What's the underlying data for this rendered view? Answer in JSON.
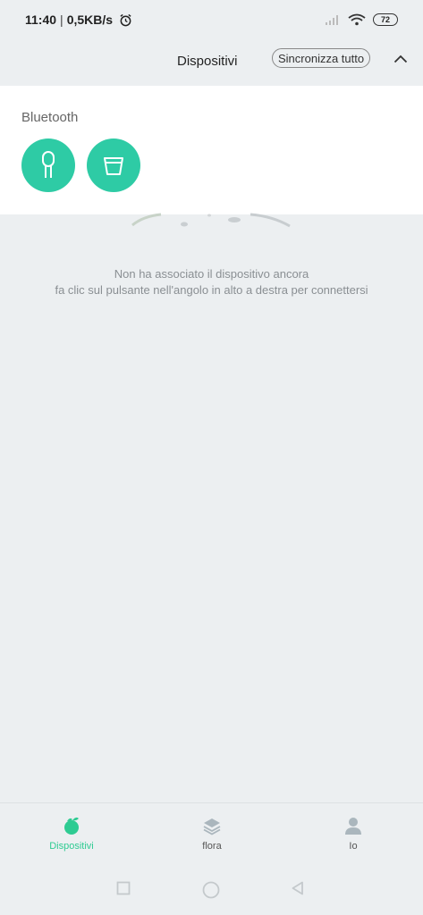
{
  "status_bar": {
    "time": "11:40",
    "separator": "|",
    "speed": "0,5KB/s",
    "battery": "72",
    "icons": [
      "alarm-icon",
      "signal-icon",
      "wifi-icon",
      "battery-icon"
    ]
  },
  "header": {
    "title": "Dispositivi",
    "sync_label": "Sincronizza tutto",
    "collapse_icon": "chevron-up-icon"
  },
  "bluetooth": {
    "label": "Bluetooth",
    "devices": [
      {
        "icon": "plant-sensor-icon"
      },
      {
        "icon": "flower-pot-icon"
      }
    ]
  },
  "empty_state": {
    "line1": "Non ha associato il dispositivo ancora",
    "line2": "fa clic sul pulsante nell'angolo in alto a destra per connettersi"
  },
  "bottom_nav": {
    "items": [
      {
        "label": "Dispositivi",
        "icon": "devices-icon",
        "active": true
      },
      {
        "label": "flora",
        "icon": "layers-icon",
        "active": false
      },
      {
        "label": "Io",
        "icon": "person-icon",
        "active": false
      }
    ]
  },
  "colors": {
    "accent": "#2ecba5",
    "nav_active": "#2ecb92",
    "background": "#eceff1"
  }
}
